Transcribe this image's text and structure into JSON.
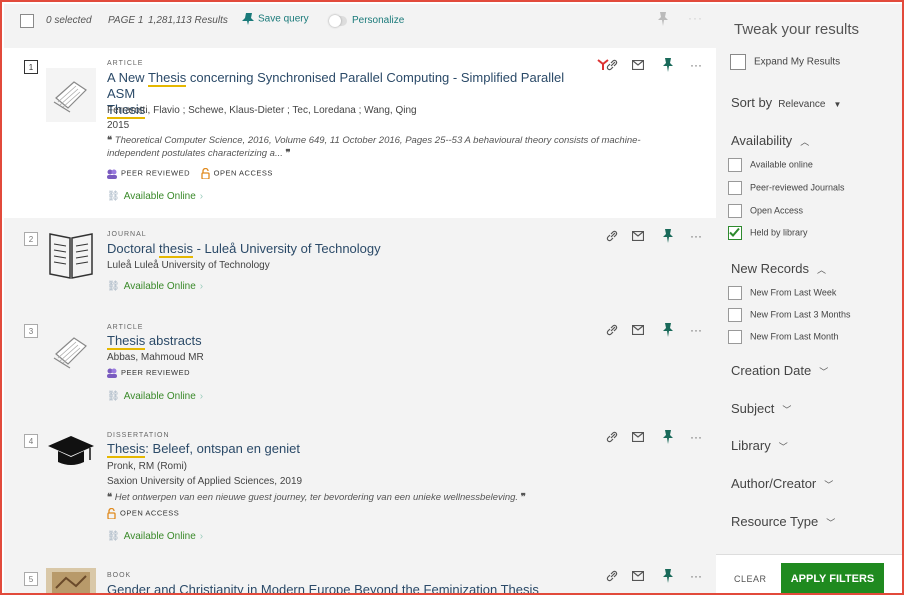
{
  "topbar": {
    "selected": "0 selected",
    "page": "PAGE 1",
    "results": "1,281,113 Results",
    "save_query": "Save query",
    "personalize": "Personalize",
    "more": "···"
  },
  "records": [
    {
      "number": "1",
      "type": "ARTICLE",
      "title_parts": [
        "A New ",
        "Thesis",
        " concerning Synchronised Parallel Computing - Simplified Parallel ASM "
      ],
      "title_line2": "Thesis",
      "authors": "Ferrarotti, Flavio ; Schewe, Klaus-Dieter ; Tec, Loredana ; Wang, Qing",
      "year": "2015",
      "snippet": "Theoretical Computer Science, 2016, Volume 649, 11 October 2016, Pages 25--53 A behavioural theory consists of machine-independent postulates characterizing a...",
      "badges": [
        "PEER REVIEWED",
        "OPEN ACCESS"
      ],
      "availability": "Available Online"
    },
    {
      "number": "2",
      "type": "JOURNAL",
      "title_parts": [
        "Doctoral ",
        "thesis",
        " - Luleå University of Technology"
      ],
      "publisher": "Luleå Luleå University of Technology",
      "availability": "Available Online"
    },
    {
      "number": "3",
      "type": "ARTICLE",
      "title_parts": [
        "Thesis",
        " abstracts"
      ],
      "authors": "Abbas, Mahmoud MR",
      "badges": [
        "PEER REVIEWED"
      ],
      "availability": "Available Online"
    },
    {
      "number": "4",
      "type": "DISSERTATION",
      "title_parts": [
        "Thesis",
        ": Beleef, ontspan en geniet"
      ],
      "authors": "Pronk, RM (Romi)",
      "publisher": "Saxion University of Applied Sciences, 2019",
      "snippet": "Het ontwerpen van een nieuwe guest journey, ter bevordering van een unieke wellnessbeleving.",
      "badges": [
        "OPEN ACCESS"
      ],
      "availability": "Available Online"
    },
    {
      "number": "5",
      "type": "BOOK",
      "title_parts": [
        "Gender and Christianity in Modern Europe Beyond the Feminization ",
        "Thesis"
      ]
    }
  ],
  "sidebar": {
    "title": "Tweak your results",
    "expand": "Expand My Results",
    "sort_label": "Sort by",
    "sort_value": "Relevance",
    "availability": {
      "label": "Availability",
      "options": [
        {
          "label": "Available online",
          "checked": false
        },
        {
          "label": "Peer-reviewed Journals",
          "checked": false
        },
        {
          "label": "Open Access",
          "checked": false
        },
        {
          "label": "Held by library",
          "checked": true
        }
      ]
    },
    "new_records": {
      "label": "New Records",
      "options": [
        {
          "label": "New From Last Week"
        },
        {
          "label": "New From Last 3 Months"
        },
        {
          "label": "New From Last Month"
        }
      ]
    },
    "groups": [
      "Creation Date",
      "Subject",
      "Library",
      "Author/Creator",
      "Resource Type"
    ],
    "clear": "CLEAR",
    "apply": "APPLY FILTERS"
  },
  "colors": {
    "accent": "#1f8a1f",
    "border": "#e24a3b",
    "title": "#2b4a68",
    "highlight": "#e6b800",
    "link": "#3a8a2a"
  }
}
